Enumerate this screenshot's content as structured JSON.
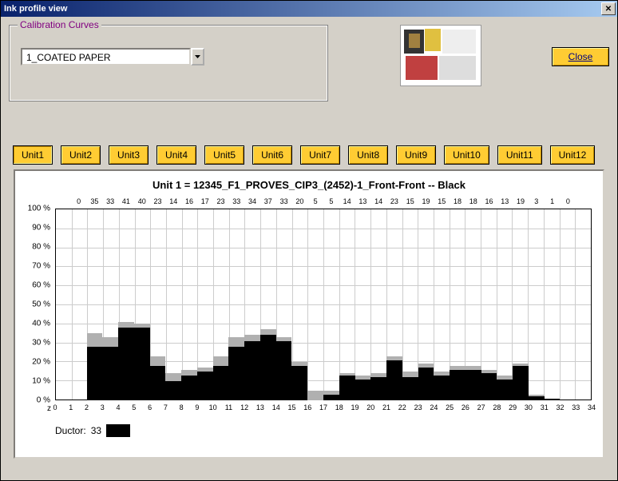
{
  "window_title": "Ink profile view",
  "fieldset_label": "Calibration Curves",
  "combo_value": "1_COATED PAPER",
  "close_label": "Close",
  "tabs": [
    "Unit1",
    "Unit2",
    "Unit3",
    "Unit4",
    "Unit5",
    "Unit6",
    "Unit7",
    "Unit8",
    "Unit9",
    "Unit10",
    "Unit11",
    "Unit12"
  ],
  "active_tab": 0,
  "chart_title": "Unit 1 = 12345_F1_PROVES_CIP3_(2452)-1_Front-Front --  Black",
  "ductor_label": "Ductor:",
  "ductor_value": "33",
  "z_label": "z",
  "chart_data": {
    "type": "bar",
    "ylim": [
      0,
      100
    ],
    "ylabels": [
      "100 %",
      "90 %",
      "80 %",
      "70 %",
      "60 %",
      "50 %",
      "40 %",
      "30 %",
      "20 %",
      "10 %",
      "0 %"
    ],
    "xlim": [
      0,
      34
    ],
    "xticks": [
      0,
      1,
      2,
      3,
      4,
      5,
      6,
      7,
      8,
      9,
      10,
      11,
      12,
      13,
      14,
      15,
      16,
      17,
      18,
      19,
      20,
      21,
      22,
      23,
      24,
      25,
      26,
      27,
      28,
      29,
      30,
      31,
      32,
      33,
      34
    ],
    "top_labels": [
      0,
      35,
      33,
      41,
      40,
      23,
      14,
      16,
      17,
      23,
      33,
      34,
      37,
      33,
      20,
      5,
      5,
      14,
      13,
      14,
      23,
      15,
      19,
      15,
      18,
      18,
      16,
      13,
      19,
      3,
      1,
      0
    ],
    "series": [
      {
        "name": "gray",
        "values": [
          0,
          35,
          33,
          41,
          40,
          23,
          14,
          16,
          17,
          23,
          33,
          34,
          37,
          33,
          20,
          5,
          5,
          14,
          13,
          14,
          23,
          15,
          19,
          15,
          18,
          18,
          16,
          13,
          19,
          3,
          1,
          0
        ]
      },
      {
        "name": "black",
        "values": [
          0,
          28,
          28,
          38,
          38,
          18,
          10,
          13,
          15,
          18,
          28,
          31,
          34,
          31,
          18,
          0,
          3,
          13,
          11,
          12,
          21,
          12,
          17,
          13,
          16,
          16,
          14,
          11,
          18,
          2,
          1,
          0
        ]
      }
    ]
  }
}
